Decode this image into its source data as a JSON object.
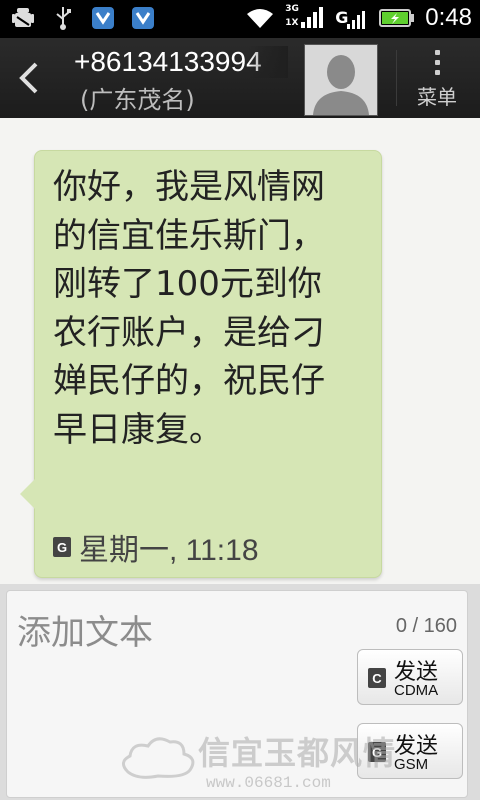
{
  "status_bar": {
    "time": "0:48",
    "network_3g": "3G",
    "network_1x": "1X",
    "network_g": "G",
    "icons": [
      "android-debug-icon",
      "usb-icon",
      "app-shield-icon-1",
      "app-shield-icon-2",
      "wifi-icon",
      "signal-3g-icon",
      "signal-g-icon",
      "battery-icon"
    ]
  },
  "header": {
    "contact_number": "+86134133994",
    "contact_location": "(广东茂名)",
    "menu_label": "菜单"
  },
  "message": {
    "text": "你好，我是风情网的信宜佳乐斯门，刚转了100元到你农行账户，是给刁婵民仔的，祝民仔早日康复。",
    "timestamp": "星期一, 11:18",
    "bubble_color": "#d6e6b5"
  },
  "compose": {
    "placeholder": "添加文本",
    "counter": "0 / 160",
    "send_cdma_label": "发送",
    "send_cdma_network": "CDMA",
    "send_gsm_label": "发送",
    "send_gsm_network": "GSM"
  },
  "watermark": {
    "text": "信宜玉都风情",
    "url": "www.06681.com"
  }
}
